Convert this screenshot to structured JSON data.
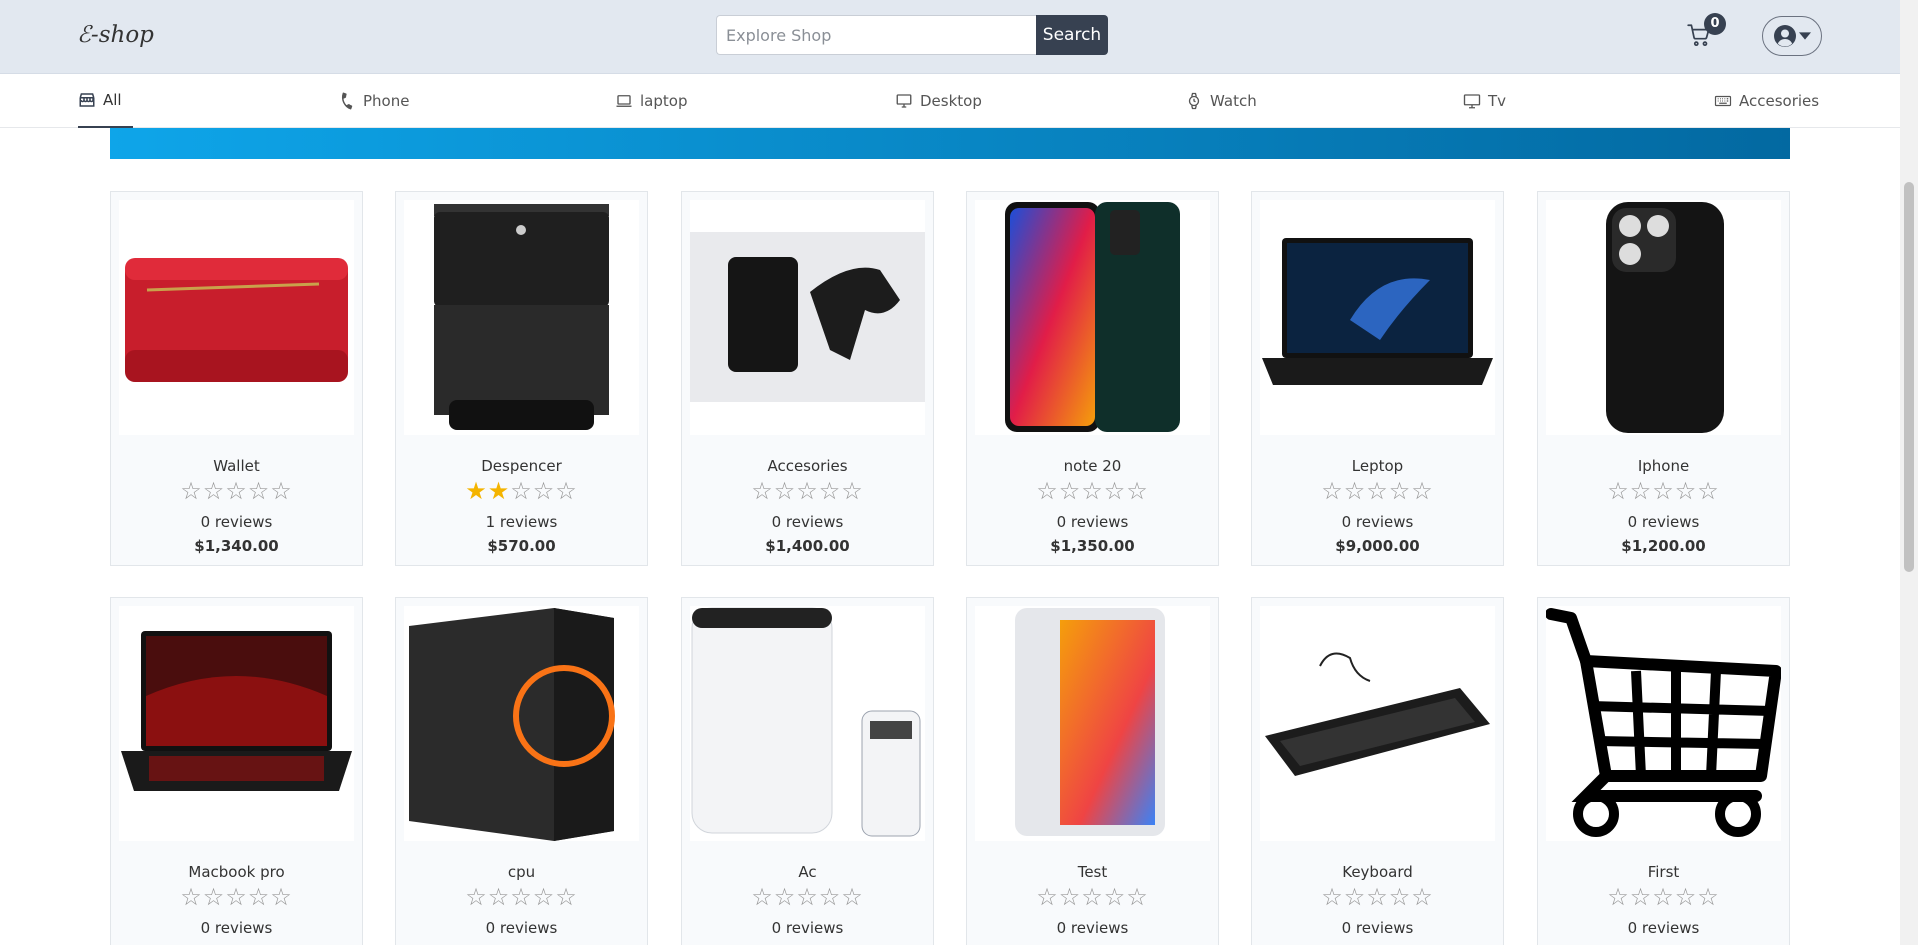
{
  "header": {
    "brand": "ℰ-shop",
    "search_placeholder": "Explore Shop",
    "search_value": "",
    "search_label": "Search",
    "cart_count": "0"
  },
  "categories": [
    {
      "label": "All",
      "icon": "store-icon"
    },
    {
      "label": "Phone",
      "icon": "phone-icon"
    },
    {
      "label": "laptop",
      "icon": "laptop-icon"
    },
    {
      "label": "Desktop",
      "icon": "desktop-icon"
    },
    {
      "label": "Watch",
      "icon": "watch-icon"
    },
    {
      "label": "Tv",
      "icon": "tv-icon"
    },
    {
      "label": "Accesories",
      "icon": "keyboard-icon"
    }
  ],
  "products": [
    {
      "name": "Wallet",
      "rating": 0,
      "reviews": "0 reviews",
      "price": "$1,340.00"
    },
    {
      "name": "Despencer",
      "rating": 2,
      "reviews": "1 reviews",
      "price": "$570.00"
    },
    {
      "name": "Accesories",
      "rating": 0,
      "reviews": "0 reviews",
      "price": "$1,400.00"
    },
    {
      "name": "note 20",
      "rating": 0,
      "reviews": "0 reviews",
      "price": "$1,350.00"
    },
    {
      "name": "Leptop",
      "rating": 0,
      "reviews": "0 reviews",
      "price": "$9,000.00"
    },
    {
      "name": "Iphone",
      "rating": 0,
      "reviews": "0 reviews",
      "price": "$1,200.00"
    },
    {
      "name": "Macbook pro",
      "rating": 0,
      "reviews": "0 reviews",
      "price": ""
    },
    {
      "name": "cpu",
      "rating": 0,
      "reviews": "0 reviews",
      "price": ""
    },
    {
      "name": "Ac",
      "rating": 0,
      "reviews": "0 reviews",
      "price": ""
    },
    {
      "name": "Test",
      "rating": 0,
      "reviews": "0 reviews",
      "price": ""
    },
    {
      "name": "Keyboard",
      "rating": 0,
      "reviews": "0 reviews",
      "price": ""
    },
    {
      "name": "First",
      "rating": 0,
      "reviews": "0 reviews",
      "price": ""
    }
  ],
  "colors": {
    "header_bg": "#e2e8f0",
    "button_dark": "#374151",
    "star_filled": "#f4b400",
    "banner_start": "#0ea5e9",
    "banner_end": "#0369a1"
  }
}
